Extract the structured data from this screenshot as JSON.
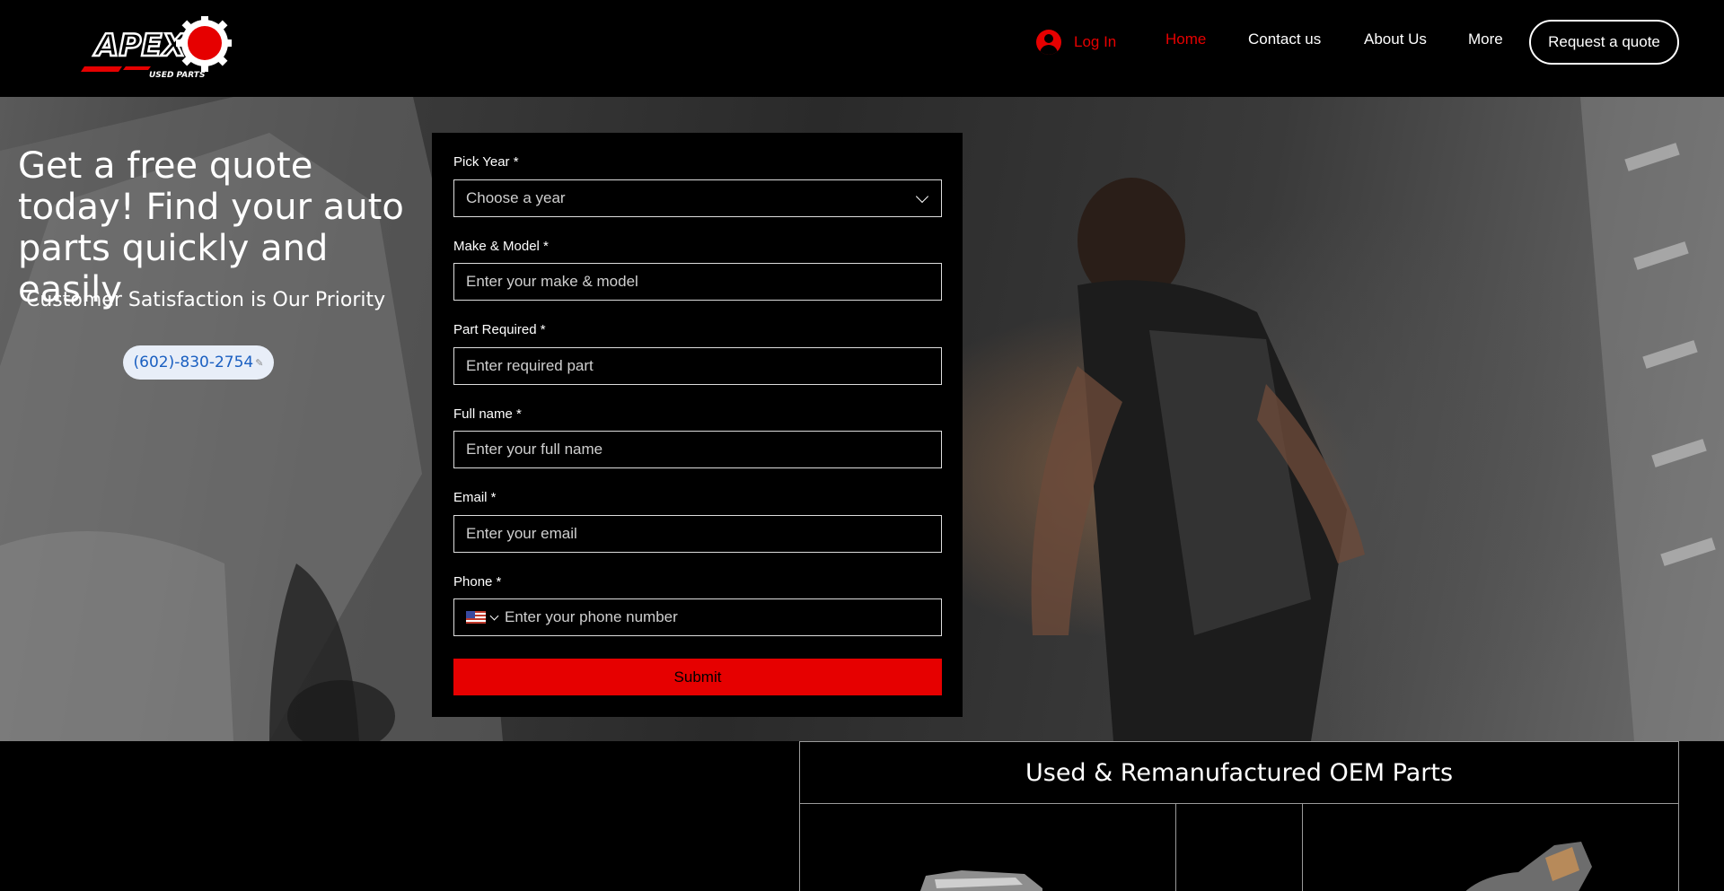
{
  "header": {
    "logo_text": "APEX",
    "logo_subtext": "USED PARTS",
    "login_label": "Log In",
    "nav": {
      "home": "Home",
      "contact": "Contact us",
      "about": "About Us",
      "more": "More"
    },
    "quote_button": "Request a quote"
  },
  "hero": {
    "headline": "Get a free quote today! Find your auto parts quickly and easily",
    "subhead": "Customer Satisfaction is Our Priority",
    "phone": "(602)-830-2754"
  },
  "form": {
    "year": {
      "label": "Pick Year *",
      "placeholder": "Choose a year"
    },
    "make_model": {
      "label": "Make & Model *",
      "placeholder": "Enter your make & model"
    },
    "part": {
      "label": "Part Required *",
      "placeholder": "Enter required part"
    },
    "full_name": {
      "label": "Full name *",
      "placeholder": "Enter your full name"
    },
    "email": {
      "label": "Email *",
      "placeholder": "Enter your email"
    },
    "phone": {
      "label": "Phone *",
      "placeholder": "Enter your phone number",
      "country_icon": "us-flag-icon"
    },
    "submit_label": "Submit"
  },
  "section": {
    "title": "Used & Remanufactured OEM Parts"
  },
  "colors": {
    "accent": "#e60000",
    "background": "#000000",
    "phone_link": "#1a5fc1"
  }
}
